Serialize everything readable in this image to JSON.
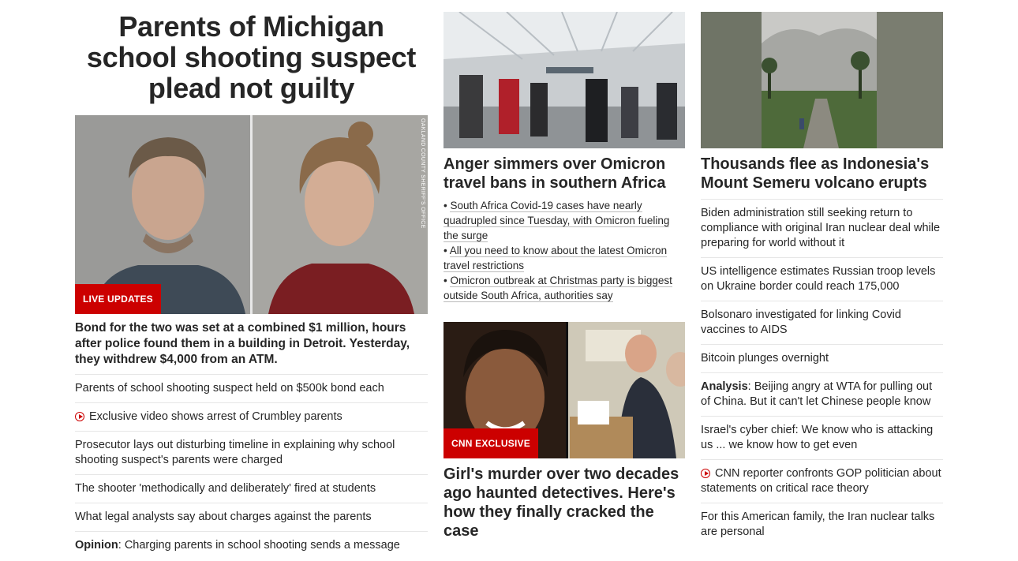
{
  "col1": {
    "headline": "Parents of Michigan school shooting suspect plead not guilty",
    "badge": "LIVE UPDATES",
    "photo_credit": "OAKLAND COUNTY SHERIFF'S OFFICE",
    "lead": "Bond for the two was set at a combined $1 million, hours after police found them in a building in Detroit. Yesterday, they withdrew $4,000 from an ATM.",
    "links": [
      {
        "text": "Parents of school shooting suspect held on $500k bond each"
      },
      {
        "text": "Exclusive video shows arrest of Crumbley parents",
        "icon": "play-icon"
      },
      {
        "text": "Prosecutor lays out disturbing timeline in explaining why school shooting suspect's parents were charged"
      },
      {
        "text": "The shooter 'methodically and deliberately' fired at students"
      },
      {
        "text": "What legal analysts say about charges against the parents"
      },
      {
        "prefix": "Opinion",
        "text": ": Charging parents in school shooting sends a message"
      }
    ]
  },
  "col2": {
    "story1": {
      "headline": "Anger simmers over Omicron travel bans in southern Africa",
      "bullets": [
        "South Africa Covid-19 cases have nearly quadrupled since Tuesday, with Omicron fueling the surge",
        "All you need to know about the latest Omicron travel restrictions",
        "Omicron outbreak at Christmas party is biggest outside South Africa, authorities say"
      ]
    },
    "story2": {
      "badge": "CNN EXCLUSIVE",
      "headline": "Girl's murder over two decades ago haunted detectives. Here's how they finally cracked the case"
    }
  },
  "col3": {
    "headline": "Thousands flee as Indonesia's Mount Semeru volcano erupts",
    "links": [
      {
        "text": "Biden administration still seeking return to compliance with original Iran nuclear deal while preparing for world without it"
      },
      {
        "text": "US intelligence estimates Russian troop levels on Ukraine border could reach 175,000"
      },
      {
        "text": "Bolsonaro investigated for linking Covid vaccines to AIDS"
      },
      {
        "text": "Bitcoin plunges overnight"
      },
      {
        "prefix": "Analysis",
        "text": ": Beijing angry at WTA for pulling out of China. But it can't let Chinese people know"
      },
      {
        "text": "Israel's cyber chief: We know who is attacking us ... we know how to get even"
      },
      {
        "text": "CNN reporter confronts GOP politician about statements on critical race theory",
        "icon": "play-icon"
      },
      {
        "text": "For this American family, the Iran nuclear talks are personal"
      }
    ]
  },
  "colors": {
    "accent": "#cc0000",
    "text": "#262626",
    "divider": "#e6e6e6"
  }
}
